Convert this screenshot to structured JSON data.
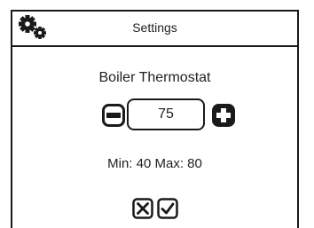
{
  "header": {
    "title": "Settings",
    "icon": "gears-icon"
  },
  "setting": {
    "label": "Boiler Thermostat",
    "value": "75",
    "min_label": "Min:",
    "min": "40",
    "max_label": "Max:",
    "max": "80",
    "range_text": "Min: 40 Max: 80"
  },
  "buttons": {
    "decrease_icon": "minus-icon",
    "increase_icon": "plus-icon",
    "cancel_icon": "close-box-icon",
    "confirm_icon": "check-box-icon"
  },
  "colors": {
    "foreground": "#1a1a1a",
    "background": "#ffffff"
  }
}
